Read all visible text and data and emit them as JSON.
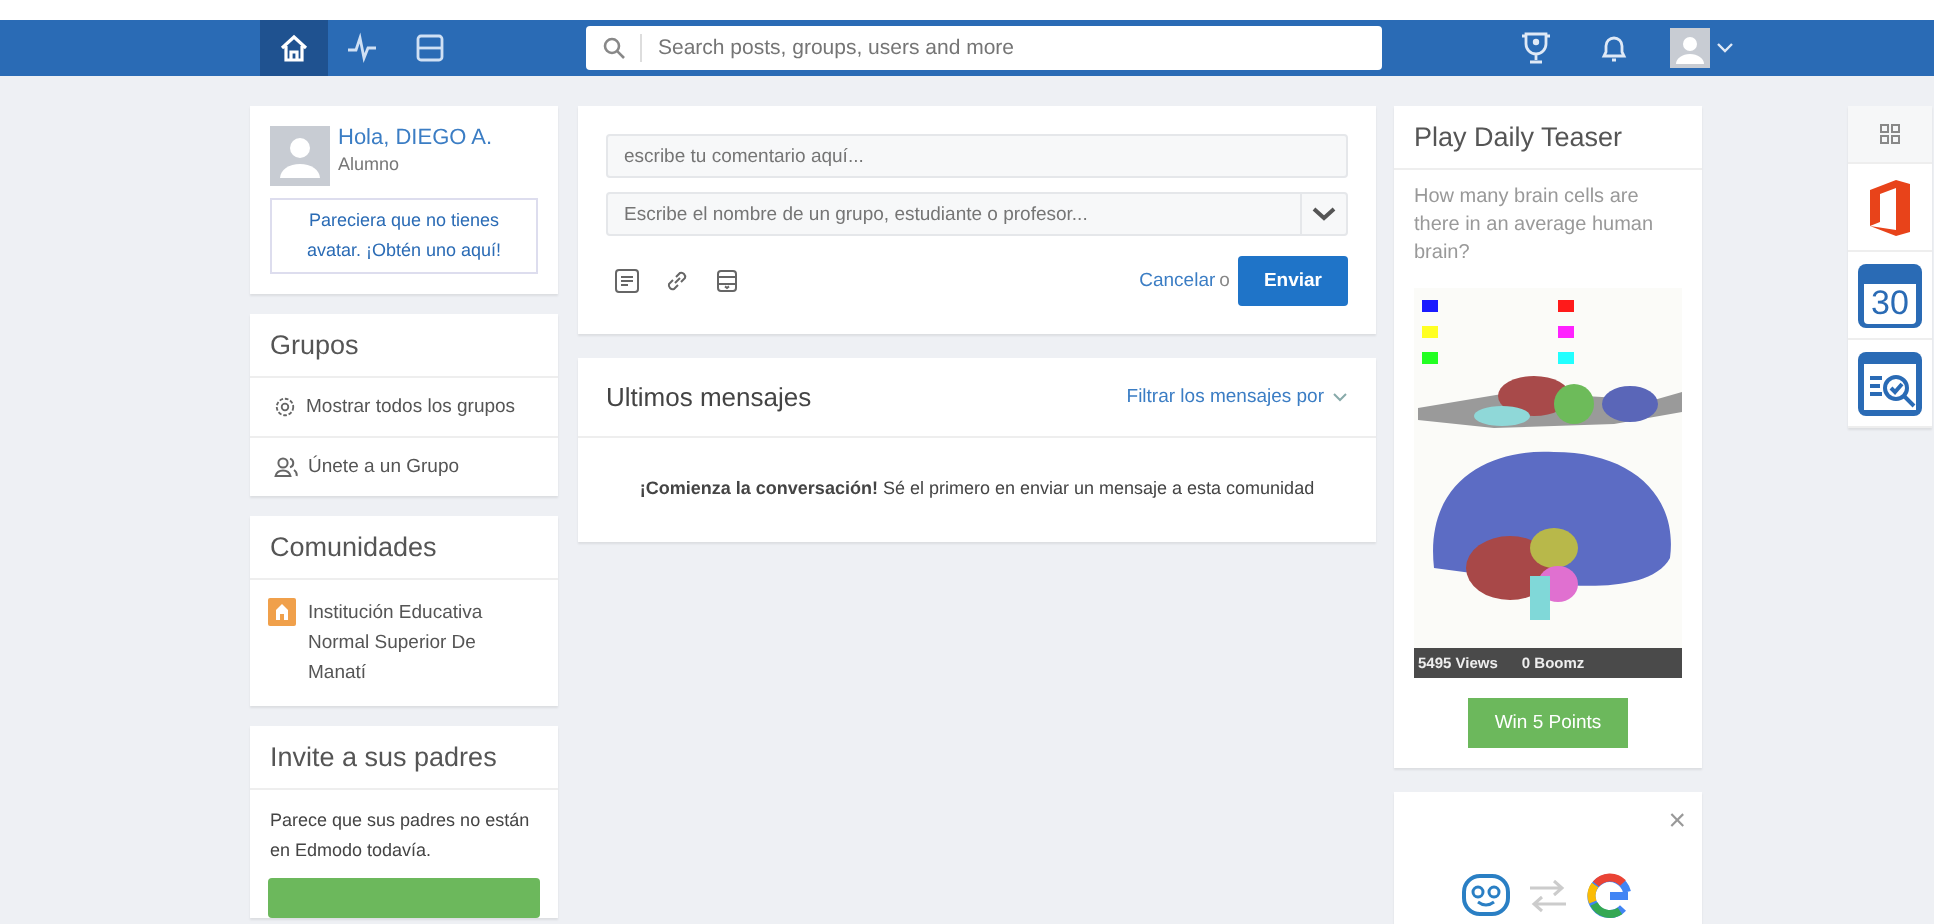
{
  "topbar": {
    "nav": [
      {
        "selected": true
      },
      {
        "selected": false
      },
      {
        "selected": false
      }
    ],
    "search": {
      "placeholder": "Search posts, groups, users and more"
    }
  },
  "profile": {
    "greeting": "Hola, DIEGO A.",
    "role": "Alumno",
    "avatar_prompt": "Pareciera que no tienes avatar. ¡Obtén uno aquí!"
  },
  "groups": {
    "title": "Grupos",
    "items": [
      {
        "label": "Mostrar todos los grupos"
      },
      {
        "label": "Únete a un Grupo"
      }
    ]
  },
  "communities": {
    "title": "Comunidades",
    "items": [
      {
        "name": "Institución Educativa Normal Superior De Manatí"
      }
    ]
  },
  "invite": {
    "title": "Invite a sus padres",
    "text": "Parece que sus padres no están en Edmodo todavía."
  },
  "composer": {
    "comment_placeholder": "escribe tu comentario aquí...",
    "recipient_placeholder": "Escribe el nombre de un grupo, estudiante o profesor...",
    "cancel": "Cancelar",
    "or": "o",
    "send": "Enviar"
  },
  "messages": {
    "title": "Ultimos mensajes",
    "filter": "Filtrar los mensajes por",
    "empty": "**¡Comienza la conversación!** Sé el primero en enviar un mensaje a esta comunidad"
  },
  "teaser": {
    "title": "Play Daily Teaser",
    "question": "How many brain cells are there in an average human brain?",
    "views": "5495 Views",
    "boomz": "0 Boomz",
    "button": "Win 5 Points"
  },
  "connect": {
    "close": "×"
  },
  "apps": [
    {
      "kind": "grid"
    },
    {
      "kind": "office"
    },
    {
      "kind": "calendar",
      "label": "30"
    },
    {
      "kind": "quiz"
    }
  ]
}
